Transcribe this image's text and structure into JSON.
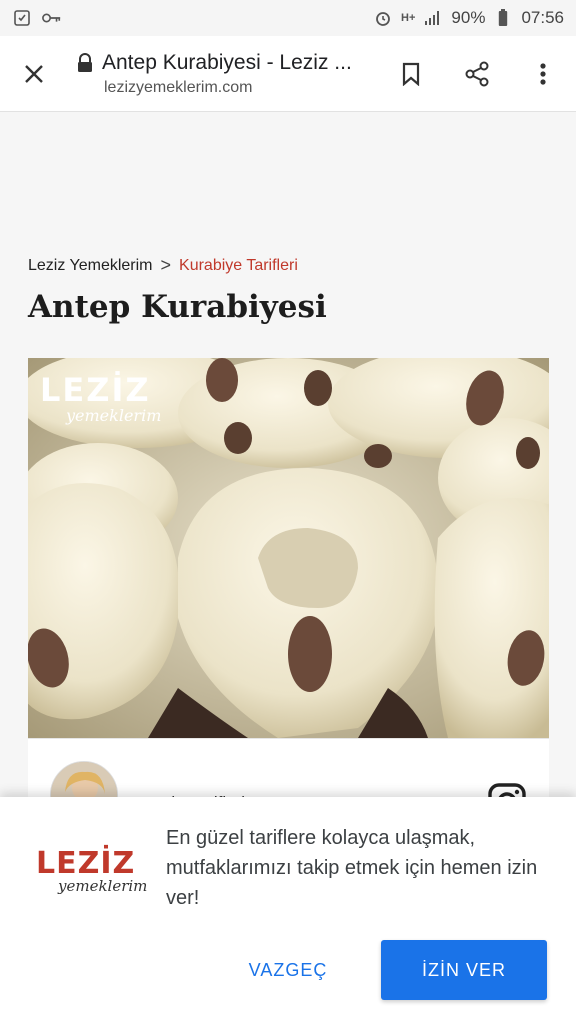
{
  "status_bar": {
    "battery": "90%",
    "time": "07:56",
    "network": "H+",
    "icons": [
      "screenshot-icon",
      "key-icon",
      "alarm-icon",
      "signal-icon",
      "battery-icon"
    ]
  },
  "toolbar": {
    "title": "Antep Kurabiyesi - Leziz ...",
    "domain": "lezizyemeklerim.com",
    "icons": [
      "close-icon",
      "lock-icon",
      "bookmark-icon",
      "share-icon",
      "more-vert-icon"
    ]
  },
  "breadcrumb": {
    "home": "Leziz Yemeklerim",
    "separator": ">",
    "category": "Kurabiye Tarifleri"
  },
  "page": {
    "title": "Antep Kurabiyesi"
  },
  "photo": {
    "logo_big": "LEZİZ",
    "logo_script": "yemeklerim"
  },
  "instagram": {
    "username": "aycanin_tarifleri"
  },
  "prompt": {
    "logo_big": "LEZİZ",
    "logo_script": "yemeklerim",
    "message": "En güzel tariflere kolayca ulaşmak, mutfaklarımızı takip etmek için hemen izin ver!",
    "cancel_label": "VAZGEÇ",
    "allow_label": "İZİN VER"
  },
  "colors": {
    "accent_blue": "#1a73e8",
    "brand_red": "#c0392b"
  }
}
